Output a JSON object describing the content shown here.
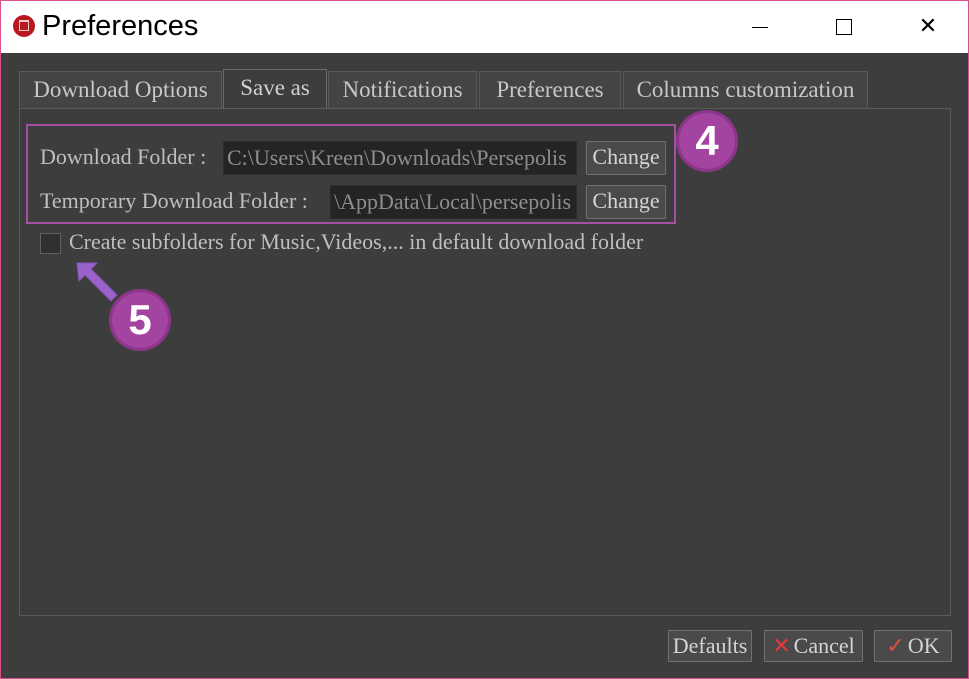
{
  "window": {
    "title": "Preferences",
    "min_icon": "minimize-icon",
    "max_icon": "maximize-icon",
    "close_icon": "close-icon",
    "close_glyph": "✕"
  },
  "tabs": [
    {
      "label": "Download Options"
    },
    {
      "label": "Save as"
    },
    {
      "label": "Notifications"
    },
    {
      "label": "Preferences"
    },
    {
      "label": "Columns customization"
    }
  ],
  "save_as": {
    "download_folder_label": "Download Folder :",
    "download_folder_value": "C:\\Users\\Kreen\\Downloads\\Persepolis",
    "temp_folder_label": "Temporary Download Folder :",
    "temp_folder_value": "\\AppData\\Local\\persepolis",
    "change_label": "Change",
    "subfolders_label": "Create subfolders for Music,Videos,... in default download folder",
    "subfolders_checked": false
  },
  "annotations": {
    "badge_4": "4",
    "badge_5": "5"
  },
  "footer": {
    "defaults_label": "Defaults",
    "cancel_label": "Cancel",
    "cancel_glyph": "✕",
    "ok_label": "OK",
    "ok_glyph": "✓"
  },
  "colors": {
    "accent": "#a244a0",
    "window_border": "#d94f8c",
    "background": "#3d3d3d"
  }
}
